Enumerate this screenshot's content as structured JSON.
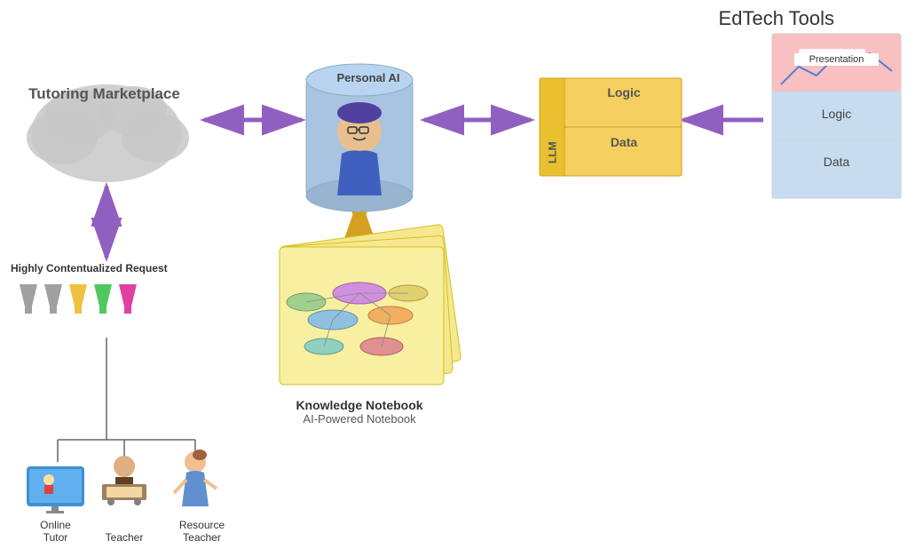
{
  "title": "EdTech Tools",
  "tutoringMarketplace": {
    "label": "Tutoring Marketplace"
  },
  "personalAI": {
    "label": "Personal AI"
  },
  "llm": {
    "label": "LLM",
    "logic": "Logic",
    "data": "Data"
  },
  "edtechCard": {
    "presentation": "Presentation",
    "logic": "Logic",
    "data": "Data"
  },
  "requestLabel": "Highly Contentualized Request",
  "knowledgeNotebook": {
    "title": "Knowledge Notebook",
    "subtitle": "AI-Powered Notebook"
  },
  "bottomFigures": [
    {
      "label": "Online\nTutor"
    },
    {
      "label": "Teacher"
    },
    {
      "label": "Resource\nTeacher"
    }
  ],
  "colors": {
    "purple": "#9060c0",
    "yellow": "#f0c040",
    "blue": "#8ab0d8",
    "cloud": "#b0b0b0"
  }
}
